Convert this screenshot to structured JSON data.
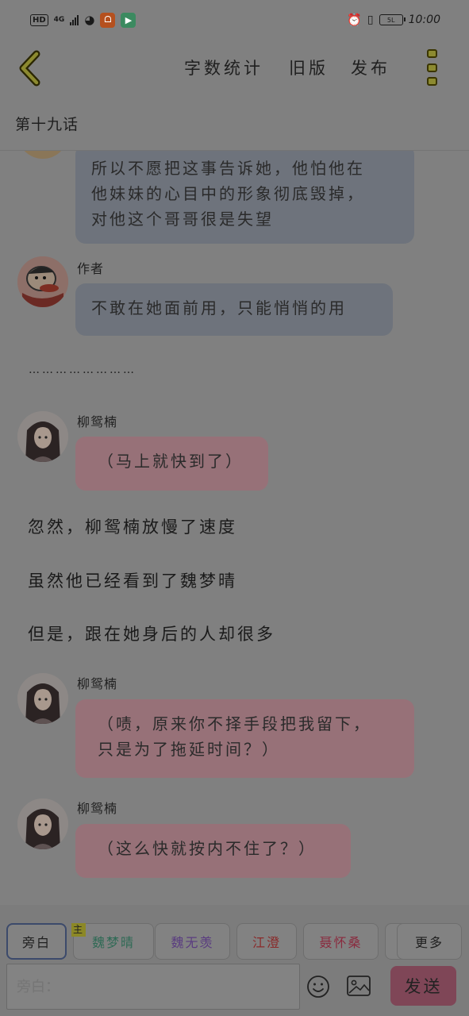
{
  "status_bar": {
    "left_icons": [
      "HD",
      "4G",
      "signal-icon",
      "globe-icon",
      "app-icon-orange",
      "app-icon-play"
    ],
    "hd_label": "HD",
    "network_label": "4G",
    "battery_text": "5L",
    "time": "10:00"
  },
  "toolbar": {
    "back_icon": "chevron-left-icon",
    "word_count_label": "字数统计",
    "old_version_label": "旧版",
    "publish_label": "发布",
    "menu_icon": "more-vertical-icon"
  },
  "chapter_title": "第十九话",
  "messages": {
    "m1_lines": [
      "所以不愿把这事告诉她，他怕他在",
      "他妹妹的心目中的形象彻底毁掉，",
      "对他这个哥哥很是失望"
    ],
    "m2_speaker": "作者",
    "m2_text": "不敢在她面前用，只能悄悄的用",
    "ellipsis": "……………………",
    "m3_speaker": "柳鸳楠",
    "m3_text": "（马上就快到了）",
    "narration1": "忽然，柳鸳楠放慢了速度",
    "narration2": "虽然他已经看到了魏梦晴",
    "narration3": "但是，跟在她身后的人却很多",
    "m4_speaker": "柳鸳楠",
    "m4_lines": [
      "（啧，原来你不择手段把我留下，",
      "只是为了拖延时间？）"
    ],
    "m5_speaker": "柳鸳楠",
    "m5_text": "（这么快就按内不住了？）"
  },
  "characters": {
    "narrator": "旁白",
    "main_badge": "主",
    "c1": "魏梦晴",
    "c2": "魏无羡",
    "c3": "江澄",
    "c4": "聂怀桑",
    "more": "更多"
  },
  "colors": {
    "c1": "#2f6a55",
    "c2": "#5a3c80",
    "c3": "#8a2a2a",
    "c4": "#8a2a3e",
    "send_button": "#7f4657",
    "gray_bubble": "#6e737c",
    "pink_bubble": "#977178"
  },
  "composer": {
    "placeholder": "旁白：",
    "emoji_icon": "emoji-icon",
    "image_icon": "image-icon",
    "send_label": "发送"
  }
}
